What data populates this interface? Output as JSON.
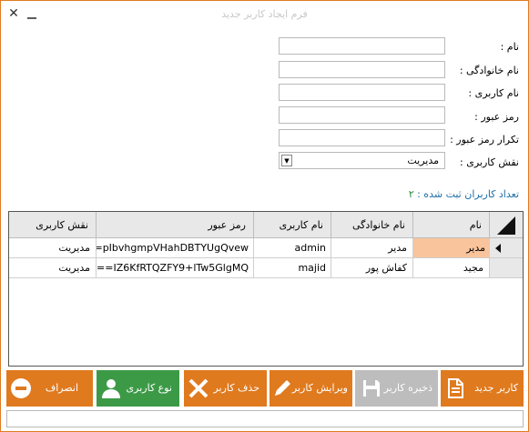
{
  "window": {
    "title": "فرم ایجاد کاربر جدید"
  },
  "form": {
    "first_name_label": "نام :",
    "last_name_label": "نام خانوادگی :",
    "username_label": "نام کاربری :",
    "password_label": "رمز عبور :",
    "password_repeat_label": "تکرار رمز عبور :",
    "role_label": "نقش کاربری :",
    "role_value": "مدیریت"
  },
  "count": {
    "label": "تعداد کاربران ثبت شده :",
    "value": "۲"
  },
  "grid": {
    "columns": [
      "نام",
      "نام خانوادگی",
      "نام کاربری",
      "رمز عبور",
      "نقش کاربری"
    ],
    "rows": [
      {
        "first_name": "مدیر",
        "last_name": "مدیر",
        "username": "admin",
        "password": "==pIbvhgmpVHahDBTYUgQvew",
        "role": "مدیریت"
      },
      {
        "first_name": "مجید",
        "last_name": "کفاش پور",
        "username": "majid",
        "password": "==IZ6KfRTQZFY9+lTw5GlgMQ",
        "role": "مدیریت"
      }
    ]
  },
  "toolbar": {
    "new_user": "کاربر جدید",
    "save_user": "ذخیره کاربر",
    "edit_user": "ویرایش کاربر",
    "delete_user": "حذف کاربر",
    "user_type": "نوع کاربری",
    "cancel": "انصراف"
  },
  "colors": {
    "accent_orange": "#e07a1f",
    "green": "#3c9a47",
    "disabled_gray": "#bdbdbd",
    "selected_cell": "#f9c49c",
    "count_text": "#1c6fa8"
  },
  "icons": [
    "close-icon",
    "minimize-icon",
    "dropdown-arrow-icon",
    "document-icon",
    "save-icon",
    "pencil-icon",
    "x-delete-icon",
    "user-icon",
    "minus-circle-icon",
    "row-pointer-icon"
  ]
}
